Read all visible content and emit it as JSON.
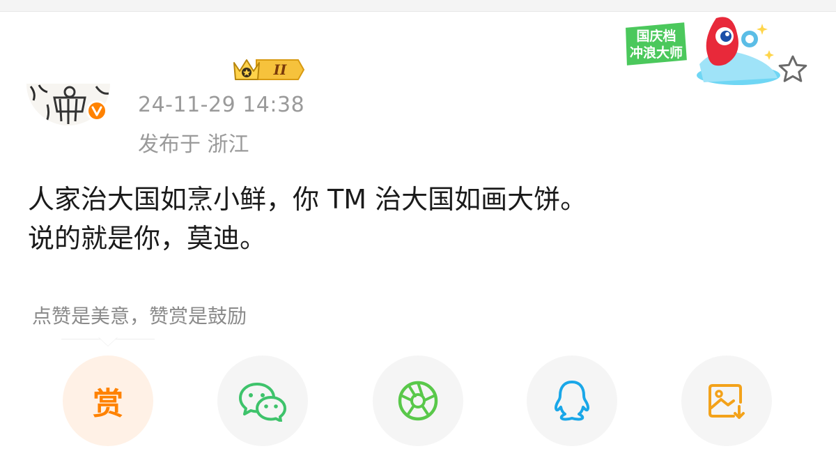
{
  "post": {
    "timestamp": "24-11-29 14:38",
    "location": "发布于 浙江",
    "level_badge": "II",
    "lines": [
      "人家治大国如烹小鲜，你 TM 治大国如画大饼。",
      "说的就是你，莫迪。"
    ]
  },
  "sticker": {
    "line1": "国庆档",
    "line2": "冲浪大师"
  },
  "tip": "点赞是美意，赞赏是鼓励",
  "share": {
    "reward_label": "赏",
    "buttons": [
      "reward",
      "wechat",
      "moments",
      "qq",
      "save-image"
    ]
  },
  "colors": {
    "accent_orange": "#ff8200",
    "wechat_green": "#3ec36b",
    "moments_green": "#59c84a",
    "qq_blue": "#1aa7e8",
    "save_orange": "#f3a21a",
    "reward_bg": "#fff1e6",
    "share_bg": "#f5f5f5",
    "meta_gray": "#9a9a9a"
  },
  "icons": [
    "crown-icon",
    "verified-icon",
    "star-icon",
    "wechat-icon",
    "moments-icon",
    "qq-icon",
    "save-image-icon"
  ]
}
